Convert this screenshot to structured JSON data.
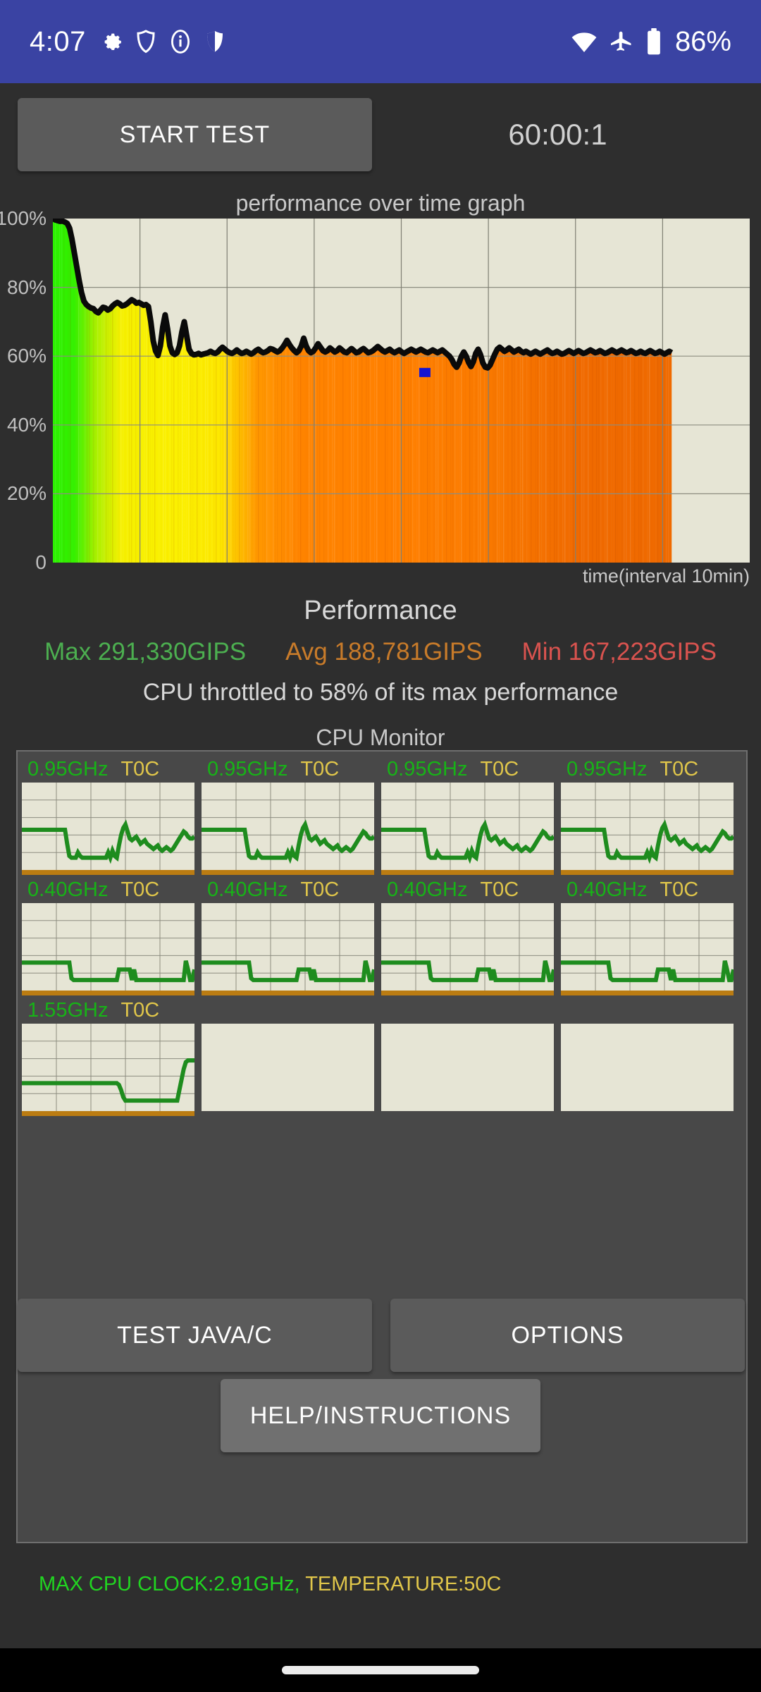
{
  "status_bar": {
    "time": "4:07",
    "battery_text": "86%",
    "left_icons": [
      "gear-icon",
      "shield-outline-icon",
      "info-icon",
      "shield-filled-icon"
    ],
    "right_icons": [
      "wifi-icon",
      "airplane-mode-icon",
      "battery-icon"
    ],
    "background_color": "#3a43a3"
  },
  "toolbar": {
    "start_test_label": "START TEST",
    "timer": "60:00:1"
  },
  "graph": {
    "title": "performance over time graph",
    "x_axis_label": "time(interval 10min)",
    "y_tick_labels": [
      "100%",
      "80%",
      "60%",
      "40%",
      "20%",
      "0"
    ]
  },
  "performance": {
    "heading": "Performance",
    "max_label": "Max 291,330GIPS",
    "avg_label": "Avg 188,781GIPS",
    "min_label": "Min 167,223GIPS",
    "max_color": "#4caf50",
    "avg_color": "#c87b2a",
    "min_color": "#d9534f",
    "throttle_note": "CPU throttled to 58% of its max performance"
  },
  "cpu_monitor": {
    "title": "CPU Monitor",
    "cells": [
      {
        "freq": "0.95GHz",
        "temp": "T0C",
        "active": true
      },
      {
        "freq": "0.95GHz",
        "temp": "T0C",
        "active": true
      },
      {
        "freq": "0.95GHz",
        "temp": "T0C",
        "active": true
      },
      {
        "freq": "0.95GHz",
        "temp": "T0C",
        "active": true
      },
      {
        "freq": "0.40GHz",
        "temp": "T0C",
        "active": true
      },
      {
        "freq": "0.40GHz",
        "temp": "T0C",
        "active": true
      },
      {
        "freq": "0.40GHz",
        "temp": "T0C",
        "active": true
      },
      {
        "freq": "0.40GHz",
        "temp": "T0C",
        "active": true
      },
      {
        "freq": "1.55GHz",
        "temp": "T0C",
        "active": true
      },
      {
        "freq": "",
        "temp": "",
        "active": false
      },
      {
        "freq": "",
        "temp": "",
        "active": false
      },
      {
        "freq": "",
        "temp": "",
        "active": false
      }
    ],
    "footer_clock": "MAX CPU CLOCK:2.91GHz,",
    "footer_temp": "TEMPERATURE:50C"
  },
  "buttons": {
    "test_java_c": "TEST JAVA/C",
    "options": "OPTIONS",
    "help_instructions": "HELP/INSTRUCTIONS"
  },
  "chart_data": {
    "type": "area",
    "title": "performance over time graph",
    "xlabel": "time(interval 10min)",
    "ylabel": "",
    "ylim": [
      0,
      100
    ],
    "ytick_labels": [
      "0",
      "20%",
      "40%",
      "60%",
      "80%",
      "100%"
    ],
    "yticks": [
      0,
      20,
      40,
      60,
      80,
      100
    ],
    "grid": true,
    "legend": "none",
    "x_gridline_count": 7,
    "data_end_fraction": 0.888,
    "marker": {
      "name": "min-marker",
      "color": "#1414d2",
      "x_fraction": 0.6,
      "y_value": 57
    },
    "series": [
      {
        "name": "performance",
        "line_color": "#0a0a0a",
        "values": [
          100,
          99.6,
          99.4,
          99.2,
          99.3,
          99.0,
          98.6,
          97.2,
          94.0,
          90.0,
          86.0,
          82.0,
          78.5,
          76.0,
          75.0,
          74.4,
          74.0,
          73.8,
          73.0,
          72.6,
          73.4,
          74.2,
          74.0,
          73.4,
          73.8,
          74.6,
          75.2,
          75.6,
          75.2,
          74.6,
          74.8,
          75.2,
          75.8,
          76.4,
          76.0,
          75.4,
          75.6,
          75.2,
          74.8,
          75.0,
          74.4,
          70.0,
          64.5,
          61.5,
          60.2,
          63.0,
          68.5,
          72.0,
          68.0,
          63.0,
          61.0,
          60.5,
          61.0,
          63.0,
          67.0,
          70.0,
          66.0,
          62.0,
          60.8,
          60.4,
          60.5,
          60.8,
          60.4,
          60.6,
          60.8,
          61.0,
          61.4,
          61.0,
          60.8,
          61.2,
          62.0,
          62.6,
          62.0,
          61.4,
          61.0,
          60.8,
          61.2,
          61.8,
          61.2,
          60.8,
          61.0,
          61.4,
          61.0,
          60.6,
          61.0,
          61.6,
          62.0,
          61.4,
          61.0,
          61.2,
          61.6,
          62.2,
          62.0,
          61.6,
          61.2,
          61.6,
          62.4,
          63.4,
          64.6,
          63.4,
          62.4,
          61.6,
          61.0,
          61.6,
          63.0,
          65.2,
          63.0,
          61.6,
          61.0,
          61.4,
          62.4,
          63.6,
          62.6,
          61.6,
          61.2,
          61.6,
          62.4,
          61.8,
          61.2,
          61.6,
          62.4,
          61.8,
          61.2,
          61.0,
          61.6,
          62.2,
          61.6,
          61.0,
          61.2,
          61.8,
          62.2,
          61.6,
          61.0,
          61.2,
          61.6,
          62.2,
          62.8,
          62.2,
          61.6,
          61.2,
          61.6,
          62.0,
          61.4,
          61.0,
          61.4,
          61.8,
          61.2,
          60.8,
          61.2,
          61.6,
          62.0,
          61.6,
          61.2,
          61.6,
          62.0,
          61.6,
          61.2,
          61.0,
          61.4,
          61.8,
          61.4,
          61.0,
          61.4,
          61.8,
          61.2,
          60.6,
          60.0,
          59.0,
          57.6,
          56.8,
          58.0,
          60.0,
          61.2,
          60.0,
          58.2,
          57.0,
          58.4,
          60.8,
          62.0,
          60.4,
          58.0,
          56.8,
          56.6,
          57.4,
          59.0,
          60.6,
          62.0,
          62.6,
          62.0,
          61.4,
          61.8,
          62.4,
          61.8,
          61.2,
          61.6,
          62.0,
          61.4,
          61.0,
          61.4,
          61.0,
          60.6,
          61.0,
          61.4,
          61.0,
          60.6,
          61.0,
          61.4,
          61.8,
          61.2,
          60.8,
          61.0,
          61.4,
          61.0,
          60.6,
          60.8,
          61.2,
          61.6,
          61.2,
          60.8,
          61.2,
          61.6,
          61.2,
          60.8,
          61.0,
          61.4,
          61.8,
          61.4,
          61.0,
          61.2,
          61.6,
          61.2,
          60.8,
          61.0,
          61.4,
          61.8,
          61.4,
          61.0,
          61.4,
          61.8,
          61.4,
          61.0,
          61.2,
          61.6,
          61.2,
          60.8,
          61.0,
          61.4,
          61.0,
          60.8,
          61.2,
          61.6,
          61.2,
          60.8,
          61.0,
          61.4,
          61.0,
          60.6,
          61.0,
          61.4,
          61.0
        ]
      }
    ],
    "fill_gradient_stops": [
      {
        "offset": 0.0,
        "color": "#2bf000"
      },
      {
        "offset": 0.035,
        "color": "#35f000"
      },
      {
        "offset": 0.07,
        "color": "#aaf000"
      },
      {
        "offset": 0.11,
        "color": "#f5f000"
      },
      {
        "offset": 0.2,
        "color": "#fbf000"
      },
      {
        "offset": 0.27,
        "color": "#fde800"
      },
      {
        "offset": 0.33,
        "color": "#ff9800"
      },
      {
        "offset": 0.4,
        "color": "#ff8400"
      },
      {
        "offset": 0.55,
        "color": "#ff8000"
      },
      {
        "offset": 0.7,
        "color": "#fa7a00"
      },
      {
        "offset": 0.85,
        "color": "#f06a00"
      },
      {
        "offset": 1.0,
        "color": "#ef6a00"
      }
    ]
  },
  "cpu_chart_data": {
    "type": "line",
    "line_color": "#1e8c1e",
    "grid_rows": 5,
    "grid_cols": 5,
    "ylim": [
      0,
      100
    ],
    "series": [
      {
        "name": "cpu0",
        "values": [
          46,
          46,
          46,
          46,
          46,
          46,
          46,
          46,
          46,
          46,
          46,
          46,
          46,
          46,
          46,
          46,
          46,
          46,
          46,
          46,
          46,
          30,
          16,
          14,
          14,
          14,
          20,
          16,
          14,
          14,
          14,
          14,
          14,
          14,
          14,
          14,
          14,
          14,
          14,
          14,
          20,
          14,
          22,
          16,
          14,
          28,
          40,
          48,
          52,
          44,
          36,
          34,
          36,
          38,
          34,
          30,
          32,
          34,
          30,
          28,
          26,
          24,
          26,
          28,
          24,
          22,
          24,
          26,
          24,
          22,
          24,
          28,
          32,
          36,
          40,
          44,
          42,
          38,
          36,
          36,
          38
        ]
      },
      {
        "name": "cpu1",
        "values": [
          46,
          46,
          46,
          46,
          46,
          46,
          46,
          46,
          46,
          46,
          46,
          46,
          46,
          46,
          46,
          46,
          46,
          46,
          46,
          46,
          46,
          30,
          16,
          14,
          14,
          14,
          20,
          16,
          14,
          14,
          14,
          14,
          14,
          14,
          14,
          14,
          14,
          14,
          14,
          14,
          20,
          14,
          22,
          16,
          14,
          28,
          40,
          48,
          52,
          44,
          36,
          34,
          36,
          38,
          34,
          30,
          32,
          34,
          30,
          28,
          26,
          24,
          26,
          28,
          24,
          22,
          24,
          26,
          24,
          22,
          24,
          28,
          32,
          36,
          40,
          44,
          42,
          38,
          36,
          36,
          38
        ]
      },
      {
        "name": "cpu2",
        "values": [
          46,
          46,
          46,
          46,
          46,
          46,
          46,
          46,
          46,
          46,
          46,
          46,
          46,
          46,
          46,
          46,
          46,
          46,
          46,
          46,
          46,
          30,
          16,
          14,
          14,
          14,
          20,
          16,
          14,
          14,
          14,
          14,
          14,
          14,
          14,
          14,
          14,
          14,
          14,
          14,
          20,
          14,
          22,
          16,
          14,
          28,
          40,
          48,
          52,
          44,
          36,
          34,
          36,
          38,
          34,
          30,
          32,
          34,
          30,
          28,
          26,
          24,
          26,
          28,
          24,
          22,
          24,
          26,
          24,
          22,
          24,
          28,
          32,
          36,
          40,
          44,
          42,
          38,
          36,
          36,
          38
        ]
      },
      {
        "name": "cpu3",
        "values": [
          46,
          46,
          46,
          46,
          46,
          46,
          46,
          46,
          46,
          46,
          46,
          46,
          46,
          46,
          46,
          46,
          46,
          46,
          46,
          46,
          46,
          30,
          16,
          14,
          14,
          14,
          20,
          16,
          14,
          14,
          14,
          14,
          14,
          14,
          14,
          14,
          14,
          14,
          14,
          14,
          20,
          14,
          22,
          16,
          14,
          28,
          40,
          48,
          52,
          44,
          36,
          34,
          36,
          38,
          34,
          30,
          32,
          34,
          30,
          28,
          26,
          24,
          26,
          28,
          24,
          22,
          24,
          26,
          24,
          22,
          24,
          28,
          32,
          36,
          40,
          44,
          42,
          38,
          36,
          36,
          38
        ]
      },
      {
        "name": "cpu4",
        "values": [
          32,
          32,
          32,
          32,
          32,
          32,
          32,
          32,
          32,
          32,
          32,
          32,
          32,
          32,
          32,
          32,
          32,
          32,
          32,
          32,
          32,
          32,
          32,
          14,
          12,
          12,
          12,
          12,
          12,
          12,
          12,
          12,
          12,
          12,
          12,
          12,
          12,
          12,
          12,
          12,
          12,
          12,
          12,
          12,
          12,
          24,
          24,
          24,
          24,
          24,
          24,
          12,
          24,
          12,
          12,
          12,
          12,
          12,
          12,
          12,
          12,
          12,
          12,
          12,
          12,
          12,
          12,
          12,
          12,
          12,
          12,
          12,
          12,
          12,
          12,
          12,
          34,
          24,
          12,
          12,
          24
        ]
      },
      {
        "name": "cpu5",
        "values": [
          32,
          32,
          32,
          32,
          32,
          32,
          32,
          32,
          32,
          32,
          32,
          32,
          32,
          32,
          32,
          32,
          32,
          32,
          32,
          32,
          32,
          32,
          32,
          14,
          12,
          12,
          12,
          12,
          12,
          12,
          12,
          12,
          12,
          12,
          12,
          12,
          12,
          12,
          12,
          12,
          12,
          12,
          12,
          12,
          12,
          24,
          24,
          24,
          24,
          24,
          24,
          12,
          24,
          12,
          12,
          12,
          12,
          12,
          12,
          12,
          12,
          12,
          12,
          12,
          12,
          12,
          12,
          12,
          12,
          12,
          12,
          12,
          12,
          12,
          12,
          12,
          34,
          24,
          12,
          12,
          24
        ]
      },
      {
        "name": "cpu6",
        "values": [
          32,
          32,
          32,
          32,
          32,
          32,
          32,
          32,
          32,
          32,
          32,
          32,
          32,
          32,
          32,
          32,
          32,
          32,
          32,
          32,
          32,
          32,
          32,
          14,
          12,
          12,
          12,
          12,
          12,
          12,
          12,
          12,
          12,
          12,
          12,
          12,
          12,
          12,
          12,
          12,
          12,
          12,
          12,
          12,
          12,
          24,
          24,
          24,
          24,
          24,
          24,
          12,
          24,
          12,
          12,
          12,
          12,
          12,
          12,
          12,
          12,
          12,
          12,
          12,
          12,
          12,
          12,
          12,
          12,
          12,
          12,
          12,
          12,
          12,
          12,
          12,
          34,
          24,
          12,
          12,
          24
        ]
      },
      {
        "name": "cpu7",
        "values": [
          32,
          32,
          32,
          32,
          32,
          32,
          32,
          32,
          32,
          32,
          32,
          32,
          32,
          32,
          32,
          32,
          32,
          32,
          32,
          32,
          32,
          32,
          32,
          14,
          12,
          12,
          12,
          12,
          12,
          12,
          12,
          12,
          12,
          12,
          12,
          12,
          12,
          12,
          12,
          12,
          12,
          12,
          12,
          12,
          12,
          24,
          24,
          24,
          24,
          24,
          24,
          12,
          24,
          12,
          12,
          12,
          12,
          12,
          12,
          12,
          12,
          12,
          12,
          12,
          12,
          12,
          12,
          12,
          12,
          12,
          12,
          12,
          12,
          12,
          12,
          12,
          34,
          24,
          12,
          12,
          24
        ]
      },
      {
        "name": "cpu8",
        "values": [
          32,
          32,
          32,
          32,
          32,
          32,
          32,
          32,
          32,
          32,
          32,
          32,
          32,
          32,
          32,
          32,
          32,
          32,
          32,
          32,
          32,
          32,
          32,
          32,
          32,
          32,
          32,
          32,
          32,
          32,
          32,
          32,
          32,
          32,
          32,
          32,
          32,
          32,
          32,
          32,
          32,
          32,
          32,
          32,
          32,
          30,
          24,
          16,
          12,
          12,
          12,
          12,
          12,
          12,
          12,
          12,
          12,
          12,
          12,
          12,
          12,
          12,
          12,
          12,
          12,
          12,
          12,
          12,
          12,
          12,
          12,
          12,
          12,
          24,
          36,
          48,
          56,
          58,
          58,
          58,
          58
        ]
      }
    ]
  }
}
